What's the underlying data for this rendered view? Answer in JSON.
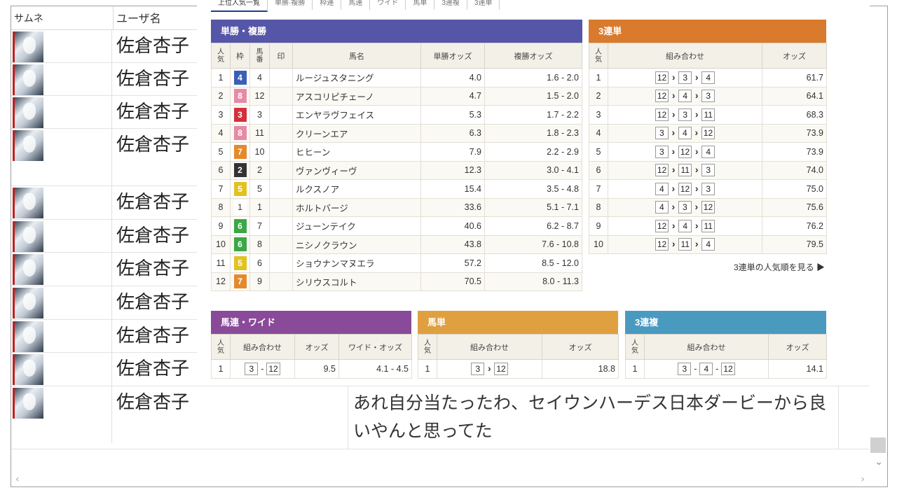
{
  "list": {
    "headers": {
      "thumbnail": "サムネ",
      "username": "ユーザ名"
    },
    "rows": [
      {
        "user": "佐倉杏子"
      },
      {
        "user": "佐倉杏子"
      },
      {
        "user": "佐倉杏子"
      },
      {
        "user": "佐倉杏子"
      },
      {
        "user": "佐倉杏子"
      },
      {
        "user": "佐倉杏子"
      },
      {
        "user": "佐倉杏子"
      },
      {
        "user": "佐倉杏子"
      },
      {
        "user": "佐倉杏子"
      },
      {
        "user": "佐倉杏子"
      },
      {
        "user": "佐倉杏子"
      }
    ],
    "last_comment_text": "あれ自分当たったわ、セイウンハーデス日本ダービーから良いやんと思ってた"
  },
  "tabs": [
    "上位人気一覧",
    "単勝·複勝",
    "枠連",
    "馬連",
    "ワイド",
    "馬単",
    "3連複",
    "3連単"
  ],
  "win_place": {
    "title": "単勝・複勝",
    "color": "#5656a8",
    "headers": {
      "pop": "人気",
      "frame": "枠",
      "num": "馬番",
      "mark": "印",
      "horse": "馬名",
      "win": "単勝オッズ",
      "place": "複勝オッズ"
    },
    "rows": [
      {
        "pop": "1",
        "frame": "4",
        "num": "4",
        "horse": "ルージュスタニング",
        "win": "4.0",
        "place": "1.6 - 2.0"
      },
      {
        "pop": "2",
        "frame": "8",
        "num": "12",
        "horse": "アスコリピチェーノ",
        "win": "4.7",
        "place": "1.5 - 2.0"
      },
      {
        "pop": "3",
        "frame": "3",
        "num": "3",
        "horse": "エンヤラヴフェイス",
        "win": "5.3",
        "place": "1.7 - 2.2"
      },
      {
        "pop": "4",
        "frame": "8",
        "num": "11",
        "horse": "クリーンエア",
        "win": "6.3",
        "place": "1.8 - 2.3"
      },
      {
        "pop": "5",
        "frame": "7",
        "num": "10",
        "horse": "ヒヒーン",
        "win": "7.9",
        "place": "2.2 - 2.9"
      },
      {
        "pop": "6",
        "frame": "2",
        "num": "2",
        "horse": "ヴァンヴィーヴ",
        "win": "12.3",
        "place": "3.0 - 4.1"
      },
      {
        "pop": "7",
        "frame": "5",
        "num": "5",
        "horse": "ルクスノア",
        "win": "15.4",
        "place": "3.5 - 4.8"
      },
      {
        "pop": "8",
        "frame": "1",
        "num": "1",
        "horse": "ホルトバージ",
        "win": "33.6",
        "place": "5.1 - 7.1"
      },
      {
        "pop": "9",
        "frame": "6",
        "num": "7",
        "horse": "ジューンテイク",
        "win": "40.6",
        "place": "6.2 - 8.7"
      },
      {
        "pop": "10",
        "frame": "6",
        "num": "8",
        "horse": "ニシノクラウン",
        "win": "43.8",
        "place": "7.6 - 10.8"
      },
      {
        "pop": "11",
        "frame": "5",
        "num": "6",
        "horse": "ショウナンマヌエラ",
        "win": "57.2",
        "place": "8.5 - 12.0"
      },
      {
        "pop": "12",
        "frame": "7",
        "num": "9",
        "horse": "シリウスコルト",
        "win": "70.5",
        "place": "8.0 - 11.3"
      }
    ],
    "frame_colors": {
      "1": "#ffffff",
      "2": "#333333",
      "3": "#d3303c",
      "4": "#3a5fb8",
      "5": "#e2c221",
      "6": "#3aa845",
      "7": "#e58a2c",
      "8": "#e68aa6"
    }
  },
  "trifecta": {
    "title": "3連単",
    "color": "#d97a2c",
    "headers": {
      "pop": "人気",
      "combo": "組み合わせ",
      "odds": "オッズ"
    },
    "rows": [
      {
        "pop": "1",
        "combo": [
          "12",
          "3",
          "4"
        ],
        "odds": "61.7"
      },
      {
        "pop": "2",
        "combo": [
          "12",
          "4",
          "3"
        ],
        "odds": "64.1"
      },
      {
        "pop": "3",
        "combo": [
          "12",
          "3",
          "11"
        ],
        "odds": "68.3"
      },
      {
        "pop": "4",
        "combo": [
          "3",
          "4",
          "12"
        ],
        "odds": "73.9"
      },
      {
        "pop": "5",
        "combo": [
          "3",
          "12",
          "4"
        ],
        "odds": "73.9"
      },
      {
        "pop": "6",
        "combo": [
          "12",
          "11",
          "3"
        ],
        "odds": "74.0"
      },
      {
        "pop": "7",
        "combo": [
          "4",
          "12",
          "3"
        ],
        "odds": "75.0"
      },
      {
        "pop": "8",
        "combo": [
          "4",
          "3",
          "12"
        ],
        "odds": "75.6"
      },
      {
        "pop": "9",
        "combo": [
          "12",
          "4",
          "11"
        ],
        "odds": "76.2"
      },
      {
        "pop": "10",
        "combo": [
          "12",
          "11",
          "4"
        ],
        "odds": "79.5"
      }
    ],
    "more_link": "3連単の人気順を見る ▶"
  },
  "quinella": {
    "title": "馬連・ワイド",
    "color": "#8a4a9a",
    "headers": {
      "pop": "人気",
      "combo": "組み合わせ",
      "odds": "オッズ",
      "wide": "ワイド・オッズ"
    },
    "rows": [
      {
        "pop": "1",
        "combo": [
          "3",
          "12"
        ],
        "odds": "9.5",
        "wide": "4.1 - 4.5"
      }
    ]
  },
  "exacta": {
    "title": "馬単",
    "color": "#e0a040",
    "headers": {
      "pop": "人気",
      "combo": "組み合わせ",
      "odds": "オッズ"
    },
    "rows": [
      {
        "pop": "1",
        "combo": [
          "3",
          "12"
        ],
        "odds": "18.8"
      }
    ]
  },
  "trio": {
    "title": "3連複",
    "color": "#4a9ac0",
    "headers": {
      "pop": "人気",
      "combo": "組み合わせ",
      "odds": "オッズ"
    },
    "rows": [
      {
        "pop": "1",
        "combo": [
          "3",
          "4",
          "12"
        ],
        "odds": "14.1"
      }
    ]
  },
  "icons": {
    "scroll_down": "chevron-down-icon",
    "more_arrow": "triangle-right-icon"
  }
}
